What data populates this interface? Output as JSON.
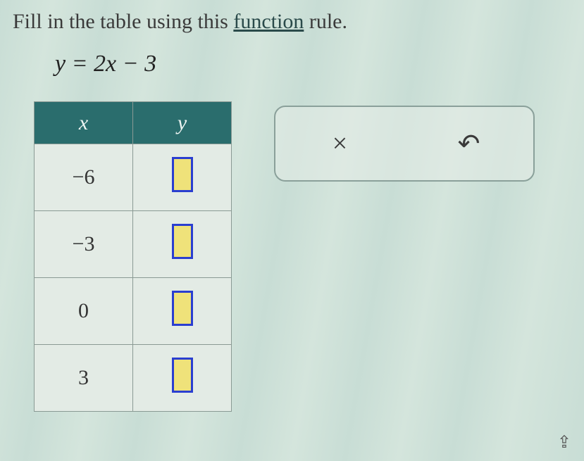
{
  "instruction": {
    "pre": "Fill in the table using this ",
    "link": "function",
    "post": " rule."
  },
  "equation": "y = 2x − 3",
  "table": {
    "headers": {
      "x": "x",
      "y": "y"
    },
    "rows": [
      {
        "x": "−6"
      },
      {
        "x": "−3"
      },
      {
        "x": "0"
      },
      {
        "x": "3"
      }
    ]
  },
  "panel": {
    "clear": "×",
    "undo": "↶"
  },
  "corner_icon": "⇪"
}
